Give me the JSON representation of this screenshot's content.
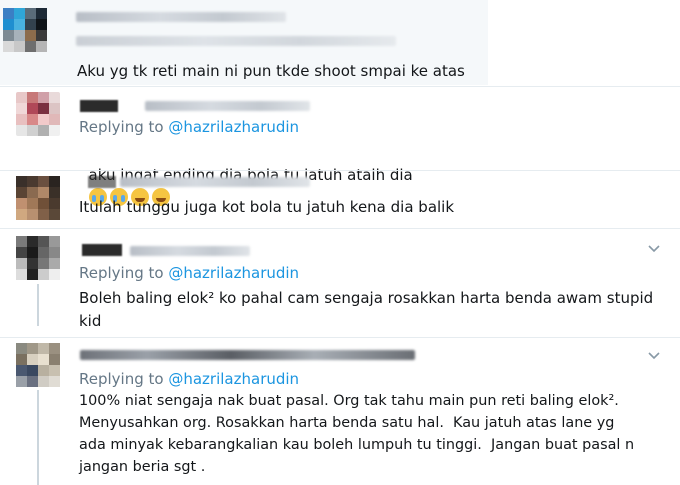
{
  "tweets": [
    {
      "replying_prefix": "",
      "handle": "",
      "text": "Aku yg tk reti main ni pun tkde shoot smpai ke atas"
    },
    {
      "replying_prefix": "Replying to",
      "handle": "@hazrilazharudin",
      "text": "aku ingat ending dia bola tu jatuh ataih dia",
      "emojis": [
        "cry-icon",
        "cry-icon",
        "laugh-icon",
        "laugh-icon"
      ]
    },
    {
      "replying_prefix": "",
      "handle": "",
      "text": "Itulah tunggu juga kot bola tu jatuh kena dia balik"
    },
    {
      "replying_prefix": "Replying to",
      "handle": "@hazrilazharudin",
      "text": "Boleh baling elok² ko pahal cam sengaja rosakkan harta benda awam stupid\nkid"
    },
    {
      "replying_prefix": "Replying to",
      "handle": "@hazrilazharudin",
      "text": "100% niat sengaja nak buat pasal. Org tak tahu main pun reti baling elok².\nMenyusahkan org. Rosakkan harta benda satu hal.  Kau jatuh atas lane yg\nada minyak kebarangkalian kau boleh lumpuh tu tinggi.  Jangan buat pasal n\njangan beria sgt ."
    }
  ],
  "colors": {
    "link": "#1b95e0",
    "muted": "#657786",
    "text": "#14171a",
    "divider": "#e6ecf0"
  }
}
